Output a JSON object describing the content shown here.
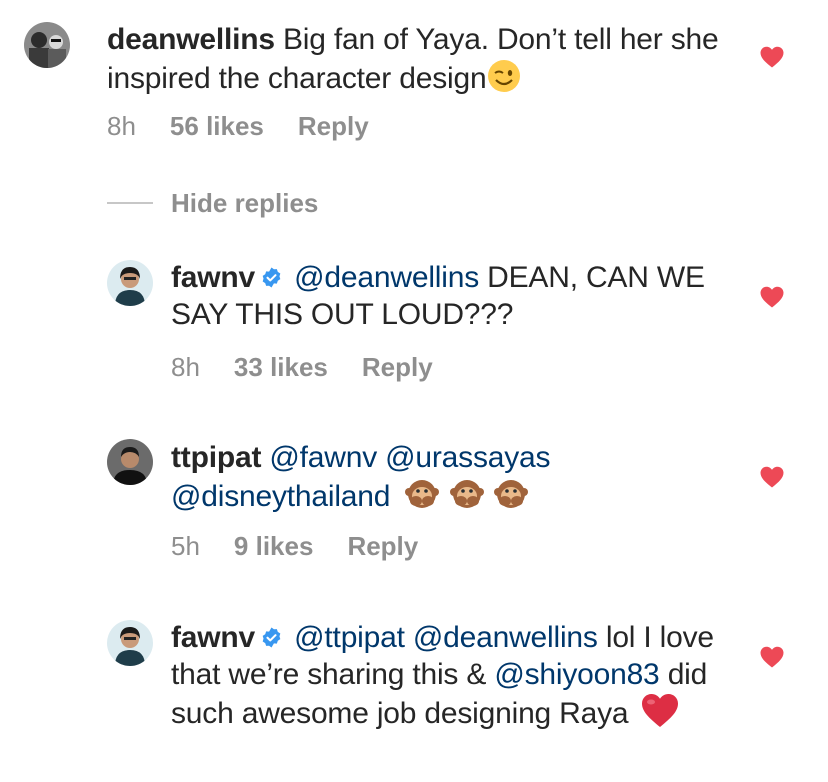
{
  "comments": [
    {
      "username": "deanwellins",
      "verified": false,
      "text_1": "Big fan of Yaya. Don’t tell her she inspired the character design",
      "emoji": "winking-face",
      "time": "8h",
      "likes": "56 likes",
      "reply": "Reply"
    },
    {
      "username": "fawnv",
      "verified": true,
      "mention_1": "@deanwellins",
      "text_1": "DEAN, CAN WE SAY THIS OUT LOUD???",
      "time": "8h",
      "likes": "33 likes",
      "reply": "Reply"
    },
    {
      "username": "ttpipat",
      "verified": false,
      "mention_1": "@fawnv",
      "mention_2": "@urassayas",
      "mention_3": "@disneythailand",
      "emoji": "speak-no-evil-monkey x3",
      "time": "5h",
      "likes": "9 likes",
      "reply": "Reply"
    },
    {
      "username": "fawnv",
      "verified": true,
      "mention_1": "@ttpipat",
      "mention_2": "@deanwellins",
      "text_1": "lol I love that we’re sharing this &",
      "mention_3": "@shiyoon83",
      "text_2": "did such awesome job designing Raya",
      "emoji": "red-heart"
    }
  ],
  "hide_replies_label": "Hide replies",
  "colors": {
    "text": "#262626",
    "muted": "#8e8e8e",
    "mention": "#00376b",
    "like_heart": "#ed4956",
    "verified": "#3897f0"
  }
}
